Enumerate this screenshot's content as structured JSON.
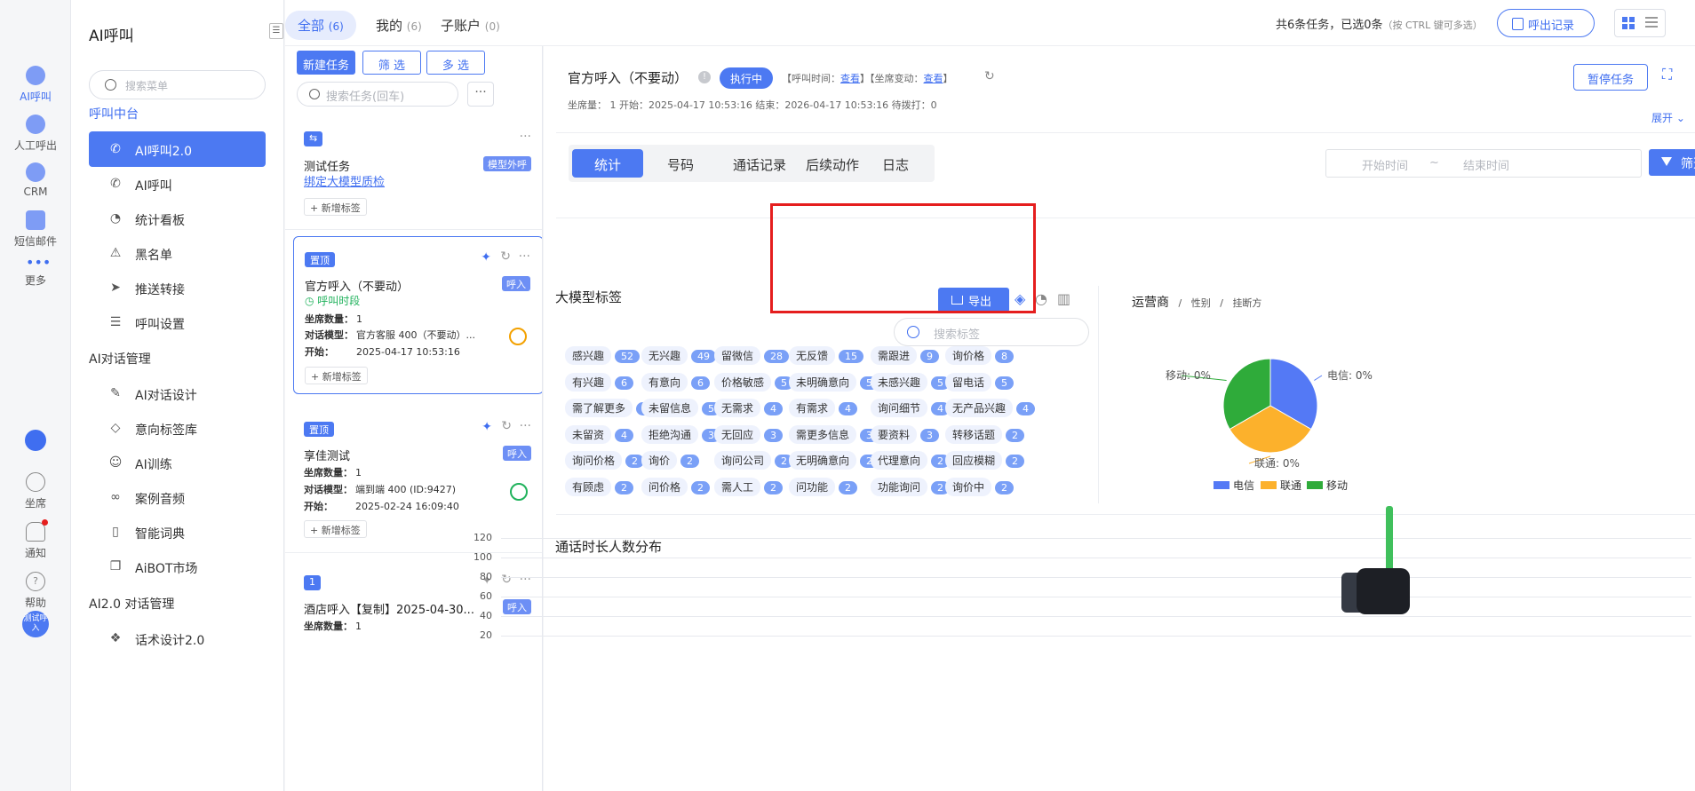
{
  "rail": {
    "items": [
      {
        "label": "AI呼叫",
        "icon": "robot-icon"
      },
      {
        "label": "人工呼出",
        "icon": "headset-icon"
      },
      {
        "label": "CRM",
        "icon": "user-icon"
      },
      {
        "label": "短信邮件",
        "icon": "message-icon"
      },
      {
        "label": "更多",
        "icon": "dots-icon"
      }
    ],
    "bottom": [
      {
        "label": "坐席",
        "icon": "agent-icon"
      },
      {
        "label": "通知",
        "icon": "bell-icon"
      },
      {
        "label": "帮助",
        "icon": "help-icon"
      }
    ],
    "avatar_text": "测试呼入"
  },
  "menu": {
    "title": "AI呼叫",
    "search_placeholder": "搜索菜单",
    "group1": "呼叫中台",
    "items1": [
      "AI呼叫2.0",
      "AI呼叫",
      "统计看板",
      "黑名单",
      "推送转接",
      "呼叫设置"
    ],
    "group2": "AI对话管理",
    "items2": [
      "AI对话设计",
      "意向标签库",
      "AI训练",
      "案例音频",
      "智能词典",
      "AiBOT市场"
    ],
    "group3": "AI2.0 对话管理",
    "items3": [
      "话术设计2.0"
    ]
  },
  "topbar": {
    "tabs": [
      {
        "label": "全部",
        "count": "(6)"
      },
      {
        "label": "我的",
        "count": "(6)"
      },
      {
        "label": "子账户",
        "count": "(0)"
      }
    ],
    "summary": "共6条任务，已选0条",
    "hint": "（按 CTRL 键可多选）",
    "call_record_label": "呼出记录"
  },
  "tasks": {
    "new_label": "新建任务",
    "filter_label": "筛 选",
    "multi_label": "多 选",
    "search_placeholder": "搜索任务(回车)",
    "add_tag_label": "+ 新增标签",
    "cards": [
      {
        "badge": "⇆",
        "title": "测试任务",
        "tag": "模型外呼",
        "link": "绑定大模型质检"
      },
      {
        "badge": "置顶",
        "title": "官方呼入（不要动）",
        "tag": "呼入",
        "sub": "呼叫时段",
        "seats_label": "坐席数量：",
        "seats": "1",
        "model_label": "对话模型：",
        "model": "官方客服 400（不要动）...",
        "start_label": "开始：",
        "start": "2025-04-17 10:53:16"
      },
      {
        "badge": "置顶",
        "title": "享佳测试",
        "tag": "呼入",
        "seats_label": "坐席数量：",
        "seats": "1",
        "model_label": "对话模型：",
        "model": "端到端 400 (ID:9427)",
        "start_label": "开始：",
        "start": "2025-02-24 16:09:40"
      },
      {
        "badge": "1",
        "title": "酒店呼入【复制】2025-04-30...",
        "tag": "呼入",
        "seats_label": "坐席数量：",
        "seats": "1"
      }
    ]
  },
  "detail": {
    "title": "官方呼入（不要动）",
    "status": "执行中",
    "meta": {
      "call_time_label": "【呼叫时间：",
      "view": "查看",
      "seat_change_label": "】【坐席变动：",
      "close": "】"
    },
    "info": "坐席量：  1    开始：2025-04-17 10:53:16    结束：2026-04-17 10:53:16    待拨打：0",
    "pause_label": "暂停任务",
    "expand_label": "展开",
    "tabs": [
      "统计",
      "号码",
      "通话记录",
      "后续动作",
      "日志"
    ],
    "start_placeholder": "开始时间",
    "tilde": "~",
    "end_placeholder": "结束时间",
    "filter_label": "筛选",
    "llm_tags_title": "大模型标签",
    "export_label": "导出",
    "tag_search_placeholder": "搜索标签",
    "tags": [
      {
        "name": "感兴趣",
        "n": "52"
      },
      {
        "name": "无兴趣",
        "n": "49"
      },
      {
        "name": "留微信",
        "n": "28"
      },
      {
        "name": "无反馈",
        "n": "15"
      },
      {
        "name": "需跟进",
        "n": "9"
      },
      {
        "name": "询价格",
        "n": "8"
      },
      {
        "name": "有兴趣",
        "n": "6"
      },
      {
        "name": "有意向",
        "n": "6"
      },
      {
        "name": "价格敏感",
        "n": "5"
      },
      {
        "name": "未明确意向",
        "n": "5"
      },
      {
        "name": "未感兴趣",
        "n": "5"
      },
      {
        "name": "留电话",
        "n": "5"
      },
      {
        "name": "需了解更多",
        "n": "5"
      },
      {
        "name": "未留信息",
        "n": "5"
      },
      {
        "name": "无需求",
        "n": "4"
      },
      {
        "name": "有需求",
        "n": "4"
      },
      {
        "name": "询问细节",
        "n": "4"
      },
      {
        "name": "无产品兴趣",
        "n": "4"
      },
      {
        "name": "未留资",
        "n": "4"
      },
      {
        "name": "拒绝沟通",
        "n": "3"
      },
      {
        "name": "无回应",
        "n": "3"
      },
      {
        "name": "需更多信息",
        "n": "3"
      },
      {
        "name": "要资料",
        "n": "3"
      },
      {
        "name": "转移话题",
        "n": "2"
      },
      {
        "name": "询问价格",
        "n": "2"
      },
      {
        "name": "询价",
        "n": "2"
      },
      {
        "name": "询问公司",
        "n": "2"
      },
      {
        "name": "无明确意向",
        "n": "2"
      },
      {
        "name": "代理意向",
        "n": "2"
      },
      {
        "name": "回应模糊",
        "n": "2"
      },
      {
        "name": "有顾虑",
        "n": "2"
      },
      {
        "name": "问价格",
        "n": "2"
      },
      {
        "name": "需人工",
        "n": "2"
      },
      {
        "name": "问功能",
        "n": "2"
      },
      {
        "name": "功能询问",
        "n": "2"
      },
      {
        "name": "询价中",
        "n": "2"
      }
    ],
    "op_title": "运营商",
    "op_sep": "/",
    "op_gender": "性别",
    "op_hangup": "挂断方",
    "duration_title": "通话时长人数分布"
  },
  "chart_data": [
    {
      "type": "pie",
      "labels": [
        "电信",
        "联通",
        "移动"
      ],
      "values": [
        0,
        0,
        0
      ],
      "display_values": [
        "电信: 0%",
        "联通: 0%",
        "移动: 0%"
      ],
      "colors": [
        "#5479f5",
        "#fcb12c",
        "#2fab3a"
      ],
      "legend": "bottom"
    },
    {
      "type": "bar",
      "title": "通话时长人数分布",
      "yticks": [
        "120",
        "100",
        "80",
        "60",
        "40",
        "20"
      ],
      "ylim": [
        0,
        120
      ],
      "grid": true
    }
  ]
}
